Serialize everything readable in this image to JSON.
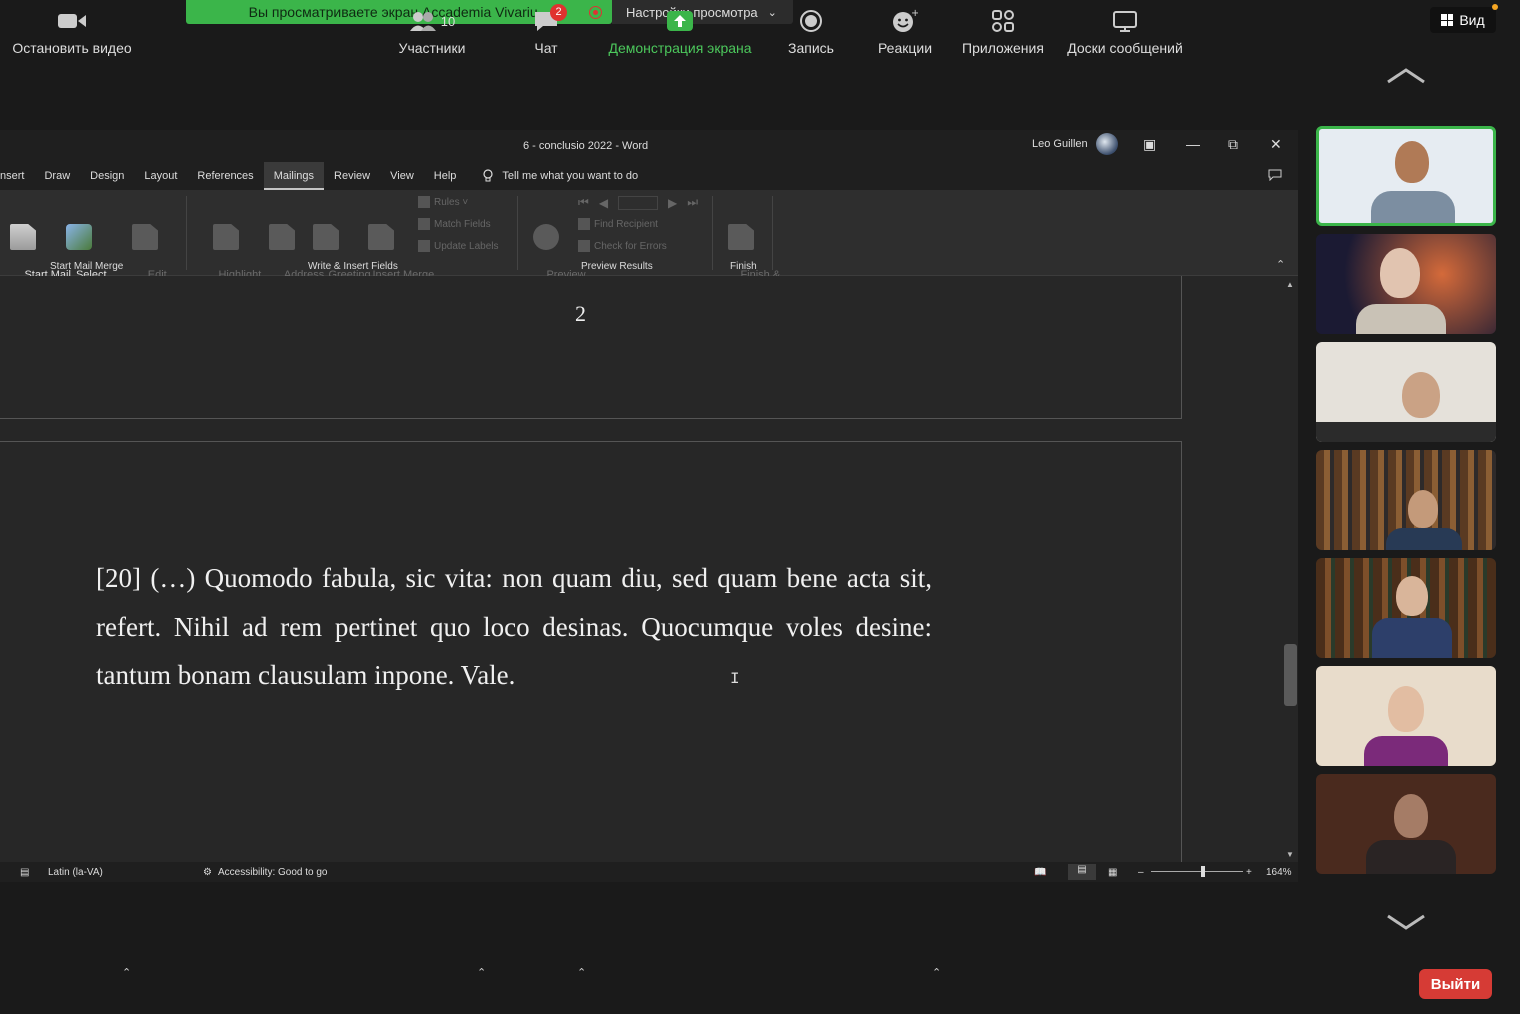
{
  "zoom_banner": {
    "sharing_text": "Вы просматриваете экран Accademia Vivariu...",
    "view_options": "Настройки просмотра",
    "view_button": "Вид"
  },
  "word": {
    "title": "6 - conclusio 2022  -  Word",
    "user": "Leo Guillen",
    "tabs": [
      "nsert",
      "Draw",
      "Design",
      "Layout",
      "References",
      "Mailings",
      "Review",
      "View",
      "Help"
    ],
    "active_tab": "Mailings",
    "tell_me": "Tell me what you want to do",
    "ribbon": {
      "start_mail_merge": "Start Mail\nMerge ˅",
      "select_recipients": "Select\nRecipients ˅",
      "edit_recipient_list": "Edit\nRecipient List",
      "highlight_merge_fields": "Highlight\nMerge Fields",
      "address_block": "Address\nBlock",
      "greeting_line": "Greeting\nLine",
      "insert_merge_field": "Insert Merge\nField ˅",
      "rules": "Rules ˅",
      "match_fields": "Match Fields",
      "update_labels": "Update Labels",
      "preview_results_btn": "Preview\nResults",
      "find_recipient": "Find Recipient",
      "check_for_errors": "Check for Errors",
      "finish_merge": "Finish &\nMerge ˅",
      "groups": [
        "Start Mail Merge",
        "Write & Insert Fields",
        "Preview Results",
        "Finish"
      ]
    },
    "page_number": "2",
    "body_text": "[20] (…) Quomodo fabula, sic vita: non quam diu, sed quam bene acta sit, refert. Nihil ad rem pertinet quo loco desinas. Quocumque voles desine: tantum bonam clausulam inpone. Vale.",
    "status": {
      "language": "Latin (la-VA)",
      "accessibility": "Accessibility: Good to go",
      "zoom": "164%"
    }
  },
  "toolbar": {
    "stop_video": "Остановить видео",
    "participants": "Участники",
    "participants_count": "10",
    "chat": "Чат",
    "chat_badge": "2",
    "share_screen": "Демонстрация экрана",
    "record": "Запись",
    "reactions": "Реакции",
    "apps": "Приложения",
    "whiteboards": "Доски сообщений",
    "leave": "Выйти"
  },
  "colors": {
    "zoom_green": "#3bb54a",
    "leave_red": "#d63b35",
    "word_dark": "#262626"
  }
}
